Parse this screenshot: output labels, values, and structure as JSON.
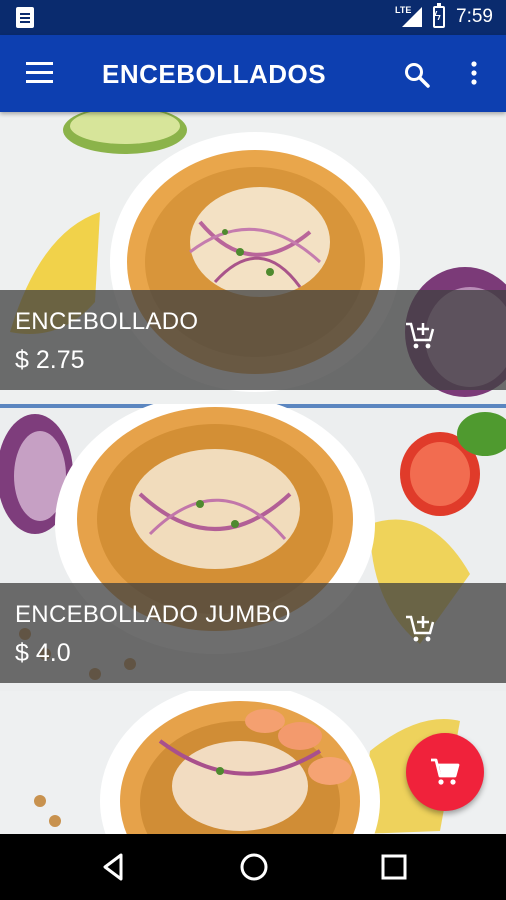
{
  "status_bar": {
    "network": "LTE",
    "time": "7:59"
  },
  "app_bar": {
    "title": "ENCEBOLLADOS"
  },
  "products": [
    {
      "name": "ENCEBOLLADO",
      "price": "$ 2.75"
    },
    {
      "name": "ENCEBOLLADO JUMBO",
      "price": "$ 4.0"
    }
  ],
  "colors": {
    "app_bar": "#0d3fb0",
    "status_bar": "#0a2b6e",
    "fab": "#f0223b",
    "overlay": "#404040"
  },
  "icons": [
    "notification-icon",
    "signal-icon",
    "battery-icon",
    "menu-icon",
    "search-icon",
    "more-vert-icon",
    "add-to-cart-icon",
    "shopping-cart-icon",
    "back-icon",
    "home-icon",
    "recents-icon"
  ]
}
